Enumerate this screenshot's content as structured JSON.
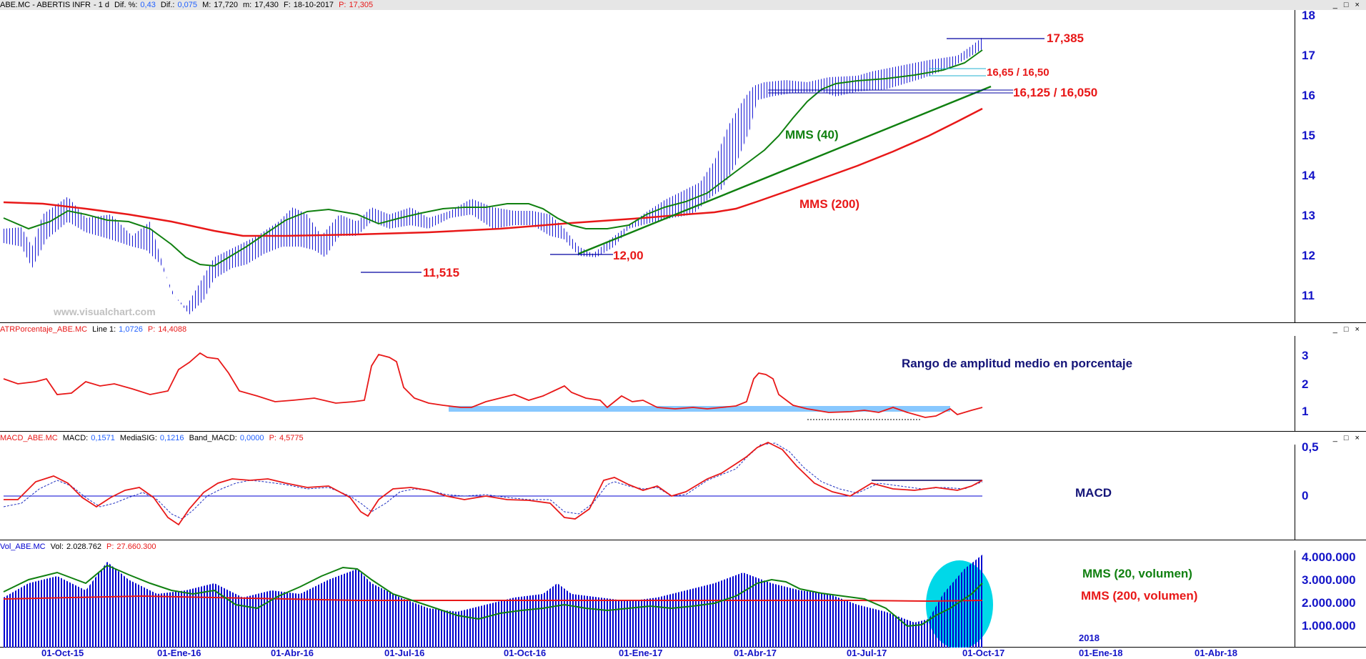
{
  "price": {
    "header": {
      "symbol": "ABE.MC - ABERTIS INFR",
      "period": "- 1 d",
      "dif_pct_label": "Dif. %:",
      "dif_pct": "0,43",
      "dif_label": "Dif.:",
      "dif": "0,075",
      "high_label": "M:",
      "high": "17,720",
      "low_label": "m:",
      "low": "17,430",
      "date_label": "F:",
      "date": "18-10-2017",
      "price_label": "P:",
      "price": "17,305"
    },
    "watermark": "www.visualchart.com",
    "axis_ticks": [
      "18",
      "17",
      "16",
      "15",
      "14",
      "13",
      "12",
      "11"
    ],
    "annotations": {
      "level_17385": "17,385",
      "level_1665": "16,65 / 16,50",
      "level_16125": "16,125 / 16,050",
      "level_1200": "12,00",
      "level_11515": "11,515",
      "mms40": "MMS (40)",
      "mms200": "MMS (200)"
    }
  },
  "atr": {
    "header": {
      "name": "ATRPorcentaje_ABE.MC",
      "line_label": "Line 1:",
      "line": "1,0726",
      "p_label": "P:",
      "p": "14,4088"
    },
    "title": "Rango de amplitud medio en porcentaje",
    "axis_ticks": [
      "3",
      "2",
      "1"
    ]
  },
  "macd": {
    "header": {
      "name": "MACD_ABE.MC",
      "macd_label": "MACD:",
      "macd": "0,1571",
      "sig_label": "MediaSIG:",
      "sig": "0,1216",
      "band_label": "Band_MACD:",
      "band": "0,0000",
      "p_label": "P:",
      "p": "4,5775"
    },
    "title": "MACD",
    "axis_ticks": [
      "0,5",
      "0"
    ]
  },
  "volume": {
    "header": {
      "name": "Vol_ABE.MC",
      "vol_label": "Vol:",
      "vol": "2.028.762",
      "p_label": "P:",
      "p": "27.660.300"
    },
    "labels": {
      "mms20": "MMS (20, volumen)",
      "mms200": "MMS (200, volumen)"
    },
    "axis_ticks": [
      "4.000.000",
      "3.000.000",
      "2.000.000",
      "1.000.000"
    ],
    "year_marker": "2018"
  },
  "dates": [
    "01-Oct-15",
    "01-Ene-16",
    "01-Abr-16",
    "01-Jul-16",
    "01-Oct-16",
    "01-Ene-17",
    "01-Abr-17",
    "01-Jul-17",
    "01-Oct-17",
    "01-Ene-18",
    "01-Abr-18"
  ],
  "colors": {
    "axis": "#1414c8",
    "price_bars": "#0000d0",
    "mms200": "#e81818",
    "mms40": "#108010",
    "trend": "#108010",
    "atr": "#e81818",
    "highlight": "#88c8ff",
    "volume": "#0000d0"
  },
  "window_buttons": "_ □ ×"
}
